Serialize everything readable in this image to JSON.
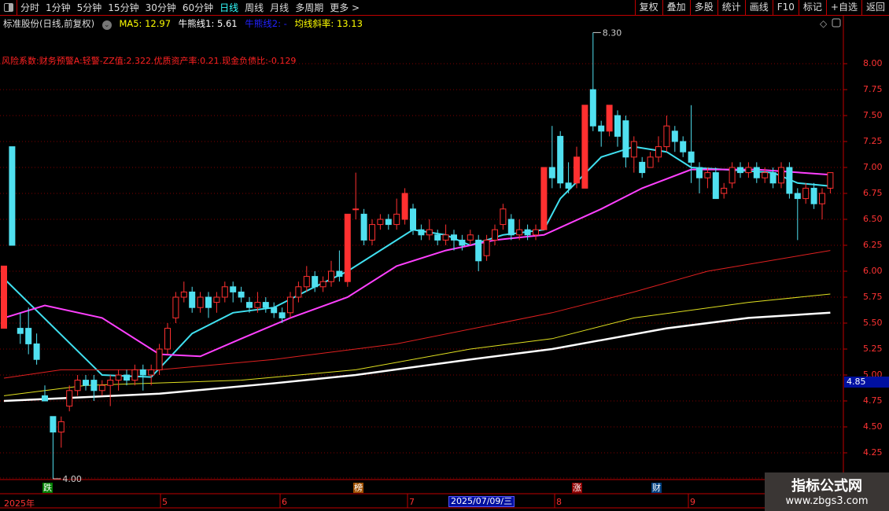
{
  "toolbar": {
    "periods": [
      "分时",
      "1分钟",
      "5分钟",
      "15分钟",
      "30分钟",
      "60分钟",
      "日线",
      "周线",
      "月线",
      "多周期",
      "更多 >"
    ],
    "active": "日线",
    "buttons": [
      "复权",
      "叠加",
      "多股",
      "统计",
      "画线",
      "F10",
      "标记",
      "+自选",
      "返回"
    ]
  },
  "info": {
    "title": "标准股份(日线,前复权)",
    "ma5": "MA5: 12.97",
    "bull1": "牛熊线1: 5.61",
    "bull2": "牛熊线2: -",
    "slope": "均线斜率: 13.13"
  },
  "warning": "风险系数:财务预警A:轻警-ZZ值:2.322.优质资产率:0.21.现金负债比:-0.129",
  "colors": {
    "up": "#ff3030",
    "down": "#50e0f0",
    "ma_cyan": "#40e0f0",
    "ma_magenta": "#ff40ff",
    "ma_red": "#e02020",
    "ma_yellow": "#e0e020",
    "ma_white": "#ffffff"
  },
  "axis": {
    "labels": [
      "8.00",
      "7.75",
      "7.50",
      "7.25",
      "7.00",
      "6.75",
      "6.50",
      "6.25",
      "6.00",
      "5.75",
      "5.50",
      "5.25",
      "5.00",
      "4.75",
      "4.50",
      "4.25"
    ],
    "current_price": "4.85",
    "max_label": "8.30",
    "min_label": "4.00"
  },
  "dates": {
    "year": "2025年",
    "months": [
      "5",
      "6",
      "7",
      "8",
      "9"
    ],
    "cursor": "2025/07/09/三"
  },
  "tags": [
    {
      "text": "跌",
      "color": "#008000"
    },
    {
      "text": "榜",
      "color": "#a05000"
    },
    {
      "text": "涨",
      "color": "#900000"
    },
    {
      "text": "财",
      "color": "#004080"
    }
  ],
  "watermark": {
    "name": "指标公式网",
    "url": "www.zbgs3.com"
  },
  "chart_data": {
    "type": "candlestick",
    "price_range": [
      4.0,
      8.4
    ],
    "candles": [
      [
        5.45,
        6.05,
        6.05,
        5.45
      ],
      [
        7.2,
        6.25,
        7.2,
        6.25
      ],
      [
        5.45,
        5.4,
        5.6,
        5.3
      ],
      [
        5.45,
        5.3,
        5.65,
        5.2
      ],
      [
        5.3,
        5.15,
        5.4,
        5.1
      ],
      [
        4.8,
        4.75,
        4.9,
        4.75
      ],
      [
        4.6,
        4.45,
        4.6,
        4.0
      ],
      [
        4.45,
        4.55,
        4.6,
        4.3
      ],
      [
        4.7,
        4.85,
        4.9,
        4.65
      ],
      [
        4.85,
        4.95,
        5.0,
        4.8
      ],
      [
        4.95,
        4.9,
        5.0,
        4.85
      ],
      [
        4.95,
        4.85,
        5.0,
        4.75
      ],
      [
        4.85,
        4.9,
        4.95,
        4.8
      ],
      [
        4.9,
        4.95,
        5.0,
        4.7
      ],
      [
        4.95,
        5.0,
        5.05,
        4.85
      ],
      [
        5.0,
        4.95,
        5.05,
        4.9
      ],
      [
        4.95,
        5.05,
        5.1,
        4.9
      ],
      [
        5.05,
        5.0,
        5.1,
        4.85
      ],
      [
        5.0,
        5.05,
        5.1,
        4.9
      ],
      [
        5.05,
        5.25,
        5.3,
        5.0
      ],
      [
        5.25,
        5.45,
        5.5,
        5.2
      ],
      [
        5.55,
        5.75,
        5.8,
        5.5
      ],
      [
        5.75,
        5.8,
        5.9,
        5.7
      ],
      [
        5.8,
        5.65,
        5.85,
        5.6
      ],
      [
        5.65,
        5.75,
        5.8,
        5.6
      ],
      [
        5.75,
        5.65,
        5.8,
        5.55
      ],
      [
        5.7,
        5.75,
        5.8,
        5.6
      ],
      [
        5.75,
        5.85,
        5.9,
        5.7
      ],
      [
        5.85,
        5.8,
        5.9,
        5.7
      ],
      [
        5.8,
        5.75,
        5.85,
        5.7
      ],
      [
        5.7,
        5.65,
        5.75,
        5.6
      ],
      [
        5.65,
        5.7,
        5.8,
        5.6
      ],
      [
        5.7,
        5.65,
        5.75,
        5.6
      ],
      [
        5.65,
        5.6,
        5.7,
        5.55
      ],
      [
        5.6,
        5.55,
        5.65,
        5.5
      ],
      [
        5.6,
        5.75,
        5.8,
        5.55
      ],
      [
        5.75,
        5.85,
        5.9,
        5.7
      ],
      [
        5.85,
        5.95,
        6.05,
        5.8
      ],
      [
        5.95,
        5.85,
        6.0,
        5.8
      ],
      [
        5.85,
        5.9,
        5.95,
        5.8
      ],
      [
        5.9,
        6.0,
        6.1,
        5.85
      ],
      [
        6.0,
        5.95,
        6.2,
        5.9
      ],
      [
        5.9,
        6.55,
        6.55,
        5.85
      ],
      [
        6.6,
        6.6,
        6.95,
        6.5
      ],
      [
        6.55,
        6.3,
        6.6,
        6.25
      ],
      [
        6.3,
        6.45,
        6.5,
        6.25
      ],
      [
        6.45,
        6.5,
        6.55,
        6.4
      ],
      [
        6.5,
        6.45,
        6.55,
        6.4
      ],
      [
        6.45,
        6.55,
        6.7,
        6.4
      ],
      [
        6.5,
        6.75,
        6.8,
        6.45
      ],
      [
        6.6,
        6.4,
        6.65,
        6.35
      ],
      [
        6.4,
        6.35,
        6.45,
        6.3
      ],
      [
        6.35,
        6.4,
        6.5,
        6.3
      ],
      [
        6.35,
        6.3,
        6.4,
        6.25
      ],
      [
        6.3,
        6.35,
        6.45,
        6.25
      ],
      [
        6.35,
        6.3,
        6.4,
        6.2
      ],
      [
        6.3,
        6.25,
        6.35,
        6.2
      ],
      [
        6.3,
        6.35,
        6.4,
        6.25
      ],
      [
        6.3,
        6.1,
        6.35,
        6.0
      ],
      [
        6.15,
        6.3,
        6.35,
        6.1
      ],
      [
        6.3,
        6.4,
        6.45,
        6.25
      ],
      [
        6.45,
        6.6,
        6.65,
        6.4
      ],
      [
        6.5,
        6.35,
        6.55,
        6.3
      ],
      [
        6.35,
        6.4,
        6.5,
        6.3
      ],
      [
        6.4,
        6.35,
        6.45,
        6.3
      ],
      [
        6.35,
        6.4,
        6.45,
        6.3
      ],
      [
        6.4,
        7.0,
        7.0,
        6.4
      ],
      [
        7.0,
        6.9,
        7.4,
        6.8
      ],
      [
        7.3,
        6.85,
        7.35,
        6.8
      ],
      [
        6.85,
        6.8,
        7.05,
        6.75
      ],
      [
        6.85,
        7.1,
        7.2,
        6.8
      ],
      [
        6.8,
        7.6,
        7.6,
        6.8
      ],
      [
        7.75,
        7.4,
        8.3,
        7.35
      ],
      [
        7.4,
        7.35,
        7.45,
        7.2
      ],
      [
        7.35,
        7.6,
        7.6,
        7.3
      ],
      [
        7.5,
        7.3,
        7.55,
        7.2
      ],
      [
        7.45,
        7.1,
        7.5,
        7.0
      ],
      [
        7.1,
        7.25,
        7.3,
        6.95
      ],
      [
        7.05,
        6.95,
        7.1,
        6.9
      ],
      [
        7.0,
        7.1,
        7.15,
        7.0
      ],
      [
        7.1,
        7.2,
        7.3,
        7.05
      ],
      [
        7.2,
        7.4,
        7.5,
        7.15
      ],
      [
        7.35,
        7.25,
        7.4,
        7.15
      ],
      [
        7.25,
        7.15,
        7.3,
        7.1
      ],
      [
        7.15,
        7.05,
        7.6,
        6.85
      ],
      [
        7.0,
        6.9,
        7.05,
        6.75
      ],
      [
        6.9,
        6.95,
        7.0,
        6.8
      ],
      [
        6.95,
        6.7,
        7.0,
        6.7
      ],
      [
        6.75,
        6.8,
        6.85,
        6.7
      ],
      [
        6.85,
        7.0,
        7.05,
        6.8
      ],
      [
        7.0,
        6.95,
        7.05,
        6.9
      ],
      [
        6.95,
        7.0,
        7.05,
        6.9
      ],
      [
        7.0,
        6.9,
        7.05,
        6.85
      ],
      [
        6.9,
        6.95,
        7.0,
        6.85
      ],
      [
        6.95,
        6.85,
        7.0,
        6.8
      ],
      [
        6.85,
        7.0,
        7.05,
        6.8
      ],
      [
        7.0,
        6.75,
        7.05,
        6.7
      ],
      [
        6.75,
        6.7,
        6.8,
        6.3
      ],
      [
        6.7,
        6.8,
        6.85,
        6.65
      ],
      [
        6.8,
        6.65,
        6.85,
        6.6
      ],
      [
        6.65,
        6.75,
        6.8,
        6.5
      ],
      [
        6.8,
        6.95,
        6.95,
        6.75
      ]
    ],
    "lines": [
      {
        "name": "ma-cyan",
        "color": "#40e0f0",
        "pts": [
          [
            0,
            5.93
          ],
          [
            12,
            5.0
          ],
          [
            18,
            4.98
          ],
          [
            23,
            5.4
          ],
          [
            28,
            5.6
          ],
          [
            33,
            5.65
          ],
          [
            38,
            5.85
          ],
          [
            42,
            6.0
          ],
          [
            47,
            6.25
          ],
          [
            50,
            6.4
          ],
          [
            54,
            6.35
          ],
          [
            57,
            6.25
          ],
          [
            61,
            6.35
          ],
          [
            66,
            6.4
          ],
          [
            68,
            6.7
          ],
          [
            73,
            7.1
          ],
          [
            77,
            7.2
          ],
          [
            81,
            7.15
          ],
          [
            84,
            7.0
          ],
          [
            88,
            6.98
          ],
          [
            94,
            6.95
          ],
          [
            97,
            6.85
          ],
          [
            101,
            6.82
          ]
        ]
      },
      {
        "name": "ma-magenta",
        "color": "#ff40ff",
        "pts": [
          [
            0,
            5.55
          ],
          [
            5,
            5.67
          ],
          [
            12,
            5.55
          ],
          [
            19,
            5.2
          ],
          [
            24,
            5.18
          ],
          [
            29,
            5.35
          ],
          [
            35,
            5.55
          ],
          [
            42,
            5.75
          ],
          [
            48,
            6.05
          ],
          [
            54,
            6.2
          ],
          [
            60,
            6.3
          ],
          [
            66,
            6.35
          ],
          [
            73,
            6.6
          ],
          [
            78,
            6.8
          ],
          [
            84,
            6.98
          ],
          [
            92,
            6.98
          ],
          [
            101,
            6.93
          ]
        ]
      },
      {
        "name": "ma-red",
        "color": "#e02020",
        "pts": [
          [
            0,
            4.97
          ],
          [
            7,
            5.05
          ],
          [
            19,
            5.05
          ],
          [
            33,
            5.15
          ],
          [
            48,
            5.3
          ],
          [
            67,
            5.6
          ],
          [
            77,
            5.8
          ],
          [
            86,
            6.0
          ],
          [
            101,
            6.2
          ]
        ]
      },
      {
        "name": "ma-yellow",
        "color": "#e0e020",
        "pts": [
          [
            0,
            4.8
          ],
          [
            10,
            4.9
          ],
          [
            29,
            4.95
          ],
          [
            43,
            5.05
          ],
          [
            57,
            5.25
          ],
          [
            67,
            5.35
          ],
          [
            77,
            5.55
          ],
          [
            91,
            5.7
          ],
          [
            101,
            5.78
          ]
        ]
      },
      {
        "name": "ma-white",
        "color": "#ffffff",
        "pts": [
          [
            0,
            4.75
          ],
          [
            19,
            4.82
          ],
          [
            33,
            4.92
          ],
          [
            43,
            5.0
          ],
          [
            57,
            5.15
          ],
          [
            67,
            5.25
          ],
          [
            81,
            5.45
          ],
          [
            91,
            5.55
          ],
          [
            101,
            5.6
          ]
        ]
      }
    ]
  }
}
